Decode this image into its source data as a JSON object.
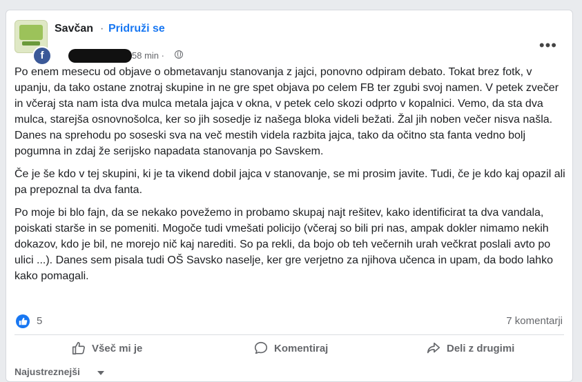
{
  "post": {
    "group_name": "Savčan",
    "separator": "·",
    "join_label": "Pridruži se",
    "time": "58 min ·",
    "more_label": "•••",
    "paragraphs": [
      "Po enem mesecu od objave o obmetavanju stanovanja z jajci, ponovno odpiram debato. Tokat brez fotk, v upanju, da tako ostane znotraj skupine in ne gre spet objava po celem FB ter zgubi svoj namen. V petek zvečer in včeraj sta nam ista dva mulca metala jajca v okna, v petek celo skozi odprto v kopalnici. Vemo, da sta dva mulca, starejša osnovnošolca, ker so jih sosedje iz našega bloka videli bežati. Žal jih noben večer nisva našla. Danes na sprehodu po soseski sva na več mestih videla razbita jajca, tako da očitno sta fanta vedno bolj pogumna in zdaj že serijsko napadata stanovanja po Savskem.",
      "Če je še kdo v tej skupini, ki je ta vikend dobil jajca v stanovanje, se mi prosim javite. Tudi, če je kdo kaj opazil ali pa prepoznal ta dva fanta.",
      "Po moje bi blo fajn, da se nekako povežemo in probamo skupaj najt rešitev, kako identificirat ta dva vandala, poiskati starše in se pomeniti. Mogoče tudi vmešati policijo (včeraj so bili pri nas, ampak dokler nimamo nekih dokazov, kdo je bil, ne morejo nič kaj narediti. So pa rekli, da bojo ob teh večernih urah večkrat poslali avto po ulici ...). Danes sem pisala tudi OŠ Savsko naselje, ker gre verjetno za njihova učenca in upam, da bodo lahko kako pomagali."
    ],
    "reaction_count": "5",
    "comments_label": "7 komentarji"
  },
  "actions": {
    "like_label": "Všeč mi je",
    "comment_label": "Komentiraj",
    "share_label": "Deli z drugimi"
  },
  "sort_label": "Najustreznejši",
  "colors": {
    "accent": "#1877f2",
    "muted_text": "#65676b",
    "background": "#e9ebee"
  },
  "icons": [
    "group-avatar",
    "page-f-icon",
    "globe-icon",
    "more-icon",
    "like-reaction-icon",
    "thumbs-up-icon",
    "comment-icon",
    "share-icon",
    "chevron-down-icon"
  ]
}
